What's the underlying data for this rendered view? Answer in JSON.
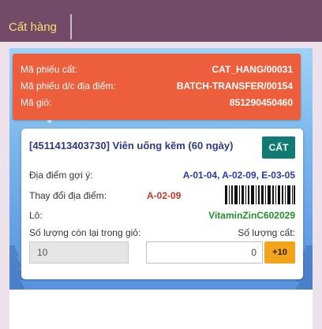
{
  "topbar": {
    "title": "Cất hàng"
  },
  "header": {
    "rows": [
      {
        "label": "Mã phiếu cất:",
        "value": "CAT_HANG/00031"
      },
      {
        "label": "Mã phiếu d/c địa điểm:",
        "value": "BATCH-TRANSFER/00154"
      },
      {
        "label": "Mã giỏ:",
        "value": "851290450460"
      }
    ]
  },
  "card": {
    "product_title": "[4511413403730] Viên uống kẽm (60 ngày)",
    "pick_button_label": "CẤT",
    "suggested_location_label": "Địa điểm gợi ý:",
    "suggested_location_value": "A-01-04, A-02-09, E-03-05",
    "change_location_label": "Thay đổi địa điểm:",
    "change_location_value": "A-02-09",
    "lot_label": "Lô:",
    "lot_value": "VitaminZinC602029",
    "remaining_qty_label": "Số lượng còn lại trong giỏ:",
    "remaining_qty_value": "10",
    "pick_qty_label": "Số lượng cất:",
    "pick_qty_value": "0",
    "plus_button_label": "+10"
  },
  "colors": {
    "topbar": "#714b67",
    "title_text": "#f5e36e",
    "header_card": "#ed5f3c",
    "pick_button": "#117a73",
    "plus_button": "#f3a41b",
    "suggested_value": "#2b39a8",
    "change_value": "#c0392b",
    "lot_value": "#20902a"
  },
  "icons": [
    "barcode-icon",
    "snowflake-decoration",
    "pine-tree-decoration"
  ]
}
